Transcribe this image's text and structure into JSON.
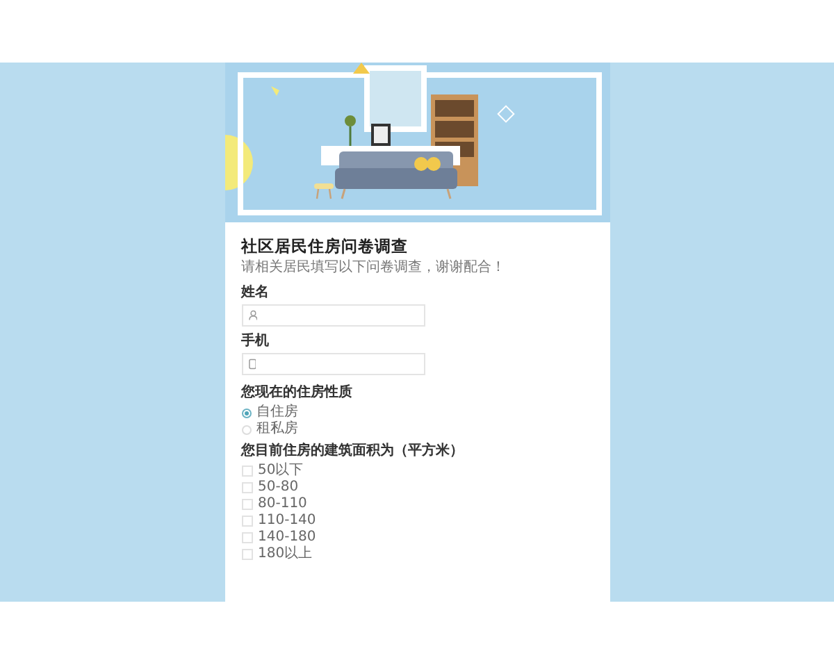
{
  "banner": {
    "kind": "living-room"
  },
  "form": {
    "title": "社区居民住房问卷调查",
    "intro": "请相关居民填写以下问卷调查，谢谢配合！",
    "fields": [
      {
        "label": "姓名",
        "kind": "person"
      },
      {
        "label": "手机",
        "kind": "phone"
      }
    ],
    "questions": [
      {
        "title": "您现在的住房性质",
        "kind": "radio",
        "options": [
          {
            "label": "自住房",
            "selected": true
          },
          {
            "label": "租私房",
            "selected": false
          }
        ]
      },
      {
        "title": "您目前住房的建筑面积为（平方米）",
        "kind": "checkbox",
        "options": [
          {
            "label": "50以下",
            "checked": false
          },
          {
            "label": "50-80",
            "checked": false
          },
          {
            "label": "80-110",
            "checked": false
          },
          {
            "label": "110-140",
            "checked": false
          },
          {
            "label": "140-180",
            "checked": false
          },
          {
            "label": "180以上",
            "checked": false
          }
        ]
      }
    ]
  }
}
